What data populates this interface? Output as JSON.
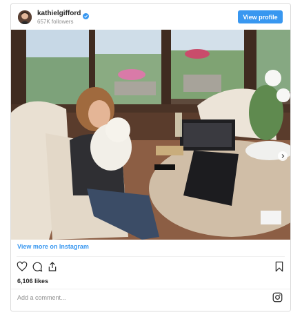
{
  "header": {
    "username": "kathielgifford",
    "followers": "657K followers",
    "view_profile_label": "View profile"
  },
  "post": {
    "view_more_label": "View more on Instagram",
    "likes": "6,106 likes",
    "comment_placeholder": "Add a comment...",
    "carousel_slides": 2,
    "active_slide": 1
  },
  "colors": {
    "accent": "#3897f0",
    "verified": "#3897f0",
    "muted_text": "#8e8e8e"
  },
  "icons": [
    "verified-icon",
    "heart-icon",
    "comment-icon",
    "share-icon",
    "bookmark-icon",
    "instagram-icon",
    "chevron-right-icon"
  ]
}
